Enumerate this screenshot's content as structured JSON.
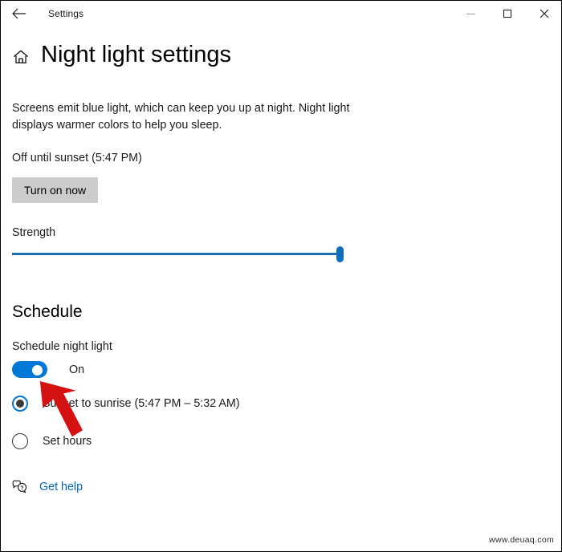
{
  "window": {
    "app_title": "Settings",
    "back_icon": "back-arrow-icon",
    "minimize_label": "Minimize",
    "maximize_label": "Maximize",
    "close_label": "Close"
  },
  "header": {
    "home_icon": "home-icon",
    "page_title": "Night light settings"
  },
  "main": {
    "description": "Screens emit blue light, which can keep you up at night. Night light displays warmer colors to help you sleep.",
    "status": "Off until sunset (5:47 PM)",
    "turn_on_label": "Turn on now",
    "strength_label": "Strength",
    "strength_value": 97
  },
  "schedule": {
    "heading": "Schedule",
    "toggle_label": "Schedule night light",
    "toggle_state": "On",
    "toggle_on": true,
    "options": [
      {
        "label": "Sunset to sunrise (5:47 PM – 5:32 AM)",
        "selected": true
      },
      {
        "label": "Set hours",
        "selected": false
      }
    ]
  },
  "footer": {
    "help_icon": "help-bubble-icon",
    "help_label": "Get help"
  },
  "annotation": {
    "arrow_color": "#d41212",
    "arrow_icon": "red-pointer-arrow"
  },
  "watermark": "www.deuaq.com",
  "colors": {
    "accent": "#0078d7",
    "slider": "#1d6fb2",
    "link": "#0067c0",
    "button_bg": "#cccccc"
  }
}
